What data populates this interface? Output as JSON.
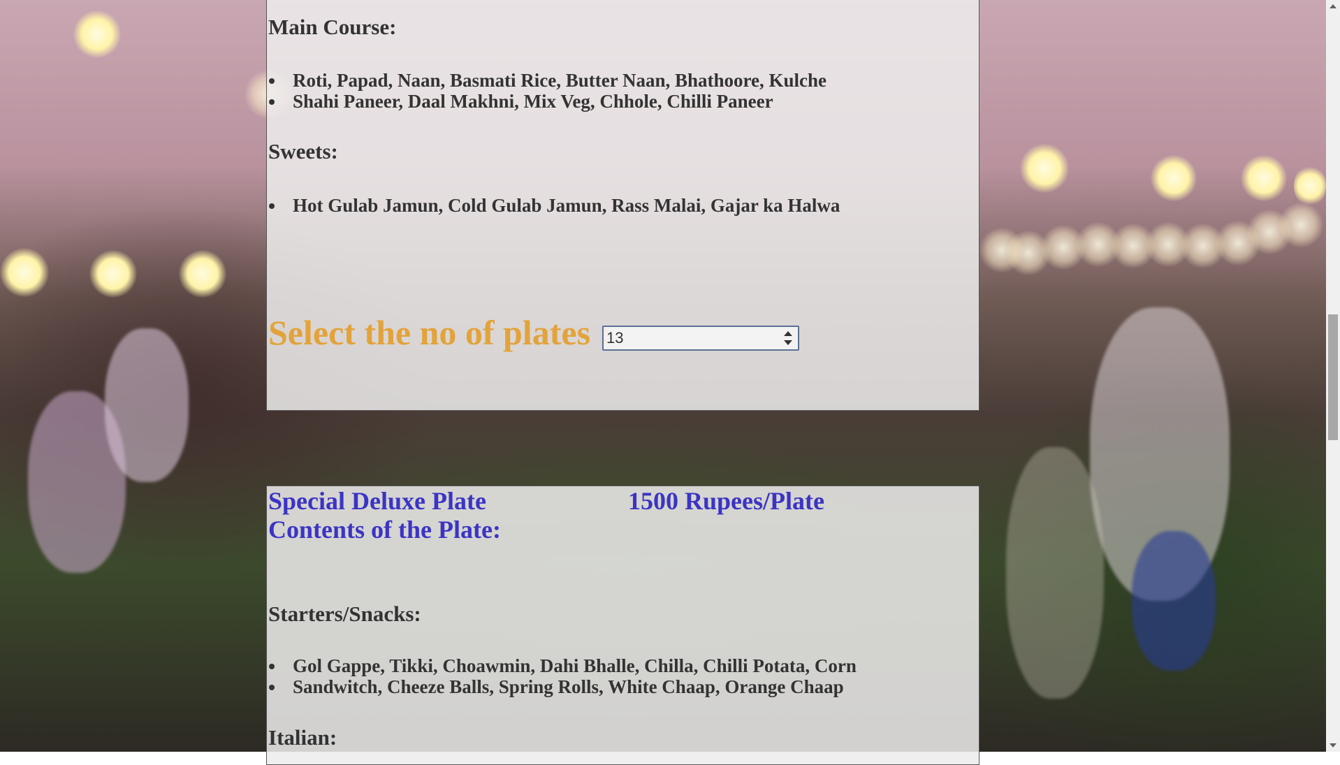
{
  "menu_top": {
    "main_course": {
      "heading": "Main Course:",
      "items": [
        "Roti, Papad, Naan, Basmati Rice, Butter Naan, Bhathoore, Kulche",
        "Shahi Paneer, Daal Makhni, Mix Veg, Chhole, Chilli Paneer"
      ]
    },
    "sweets": {
      "heading": "Sweets:",
      "items": [
        "Hot Gulab Jamun, Cold Gulab Jamun, Rass Malai, Gajar ka Halwa"
      ]
    },
    "plates": {
      "label": "Select the no of plates :",
      "value": "13"
    }
  },
  "special_deluxe": {
    "name": "Special Deluxe Plate",
    "price": "1500 Rupees/Plate",
    "contents_label": "Contents of the Plate:",
    "starters": {
      "heading": "Starters/Snacks:",
      "items": [
        "Gol Gappe, Tikki, Choawmin, Dahi Bhalle, Chilla, Chilli Potata, Corn",
        "Sandwitch, Cheeze Balls, Spring Rolls, White Chaap, Orange Chaap"
      ]
    },
    "italian": {
      "heading": "Italian:"
    }
  },
  "colors": {
    "plate_title": "#3b34c4",
    "plates_label": "#e3a33a",
    "text": "#333333"
  }
}
